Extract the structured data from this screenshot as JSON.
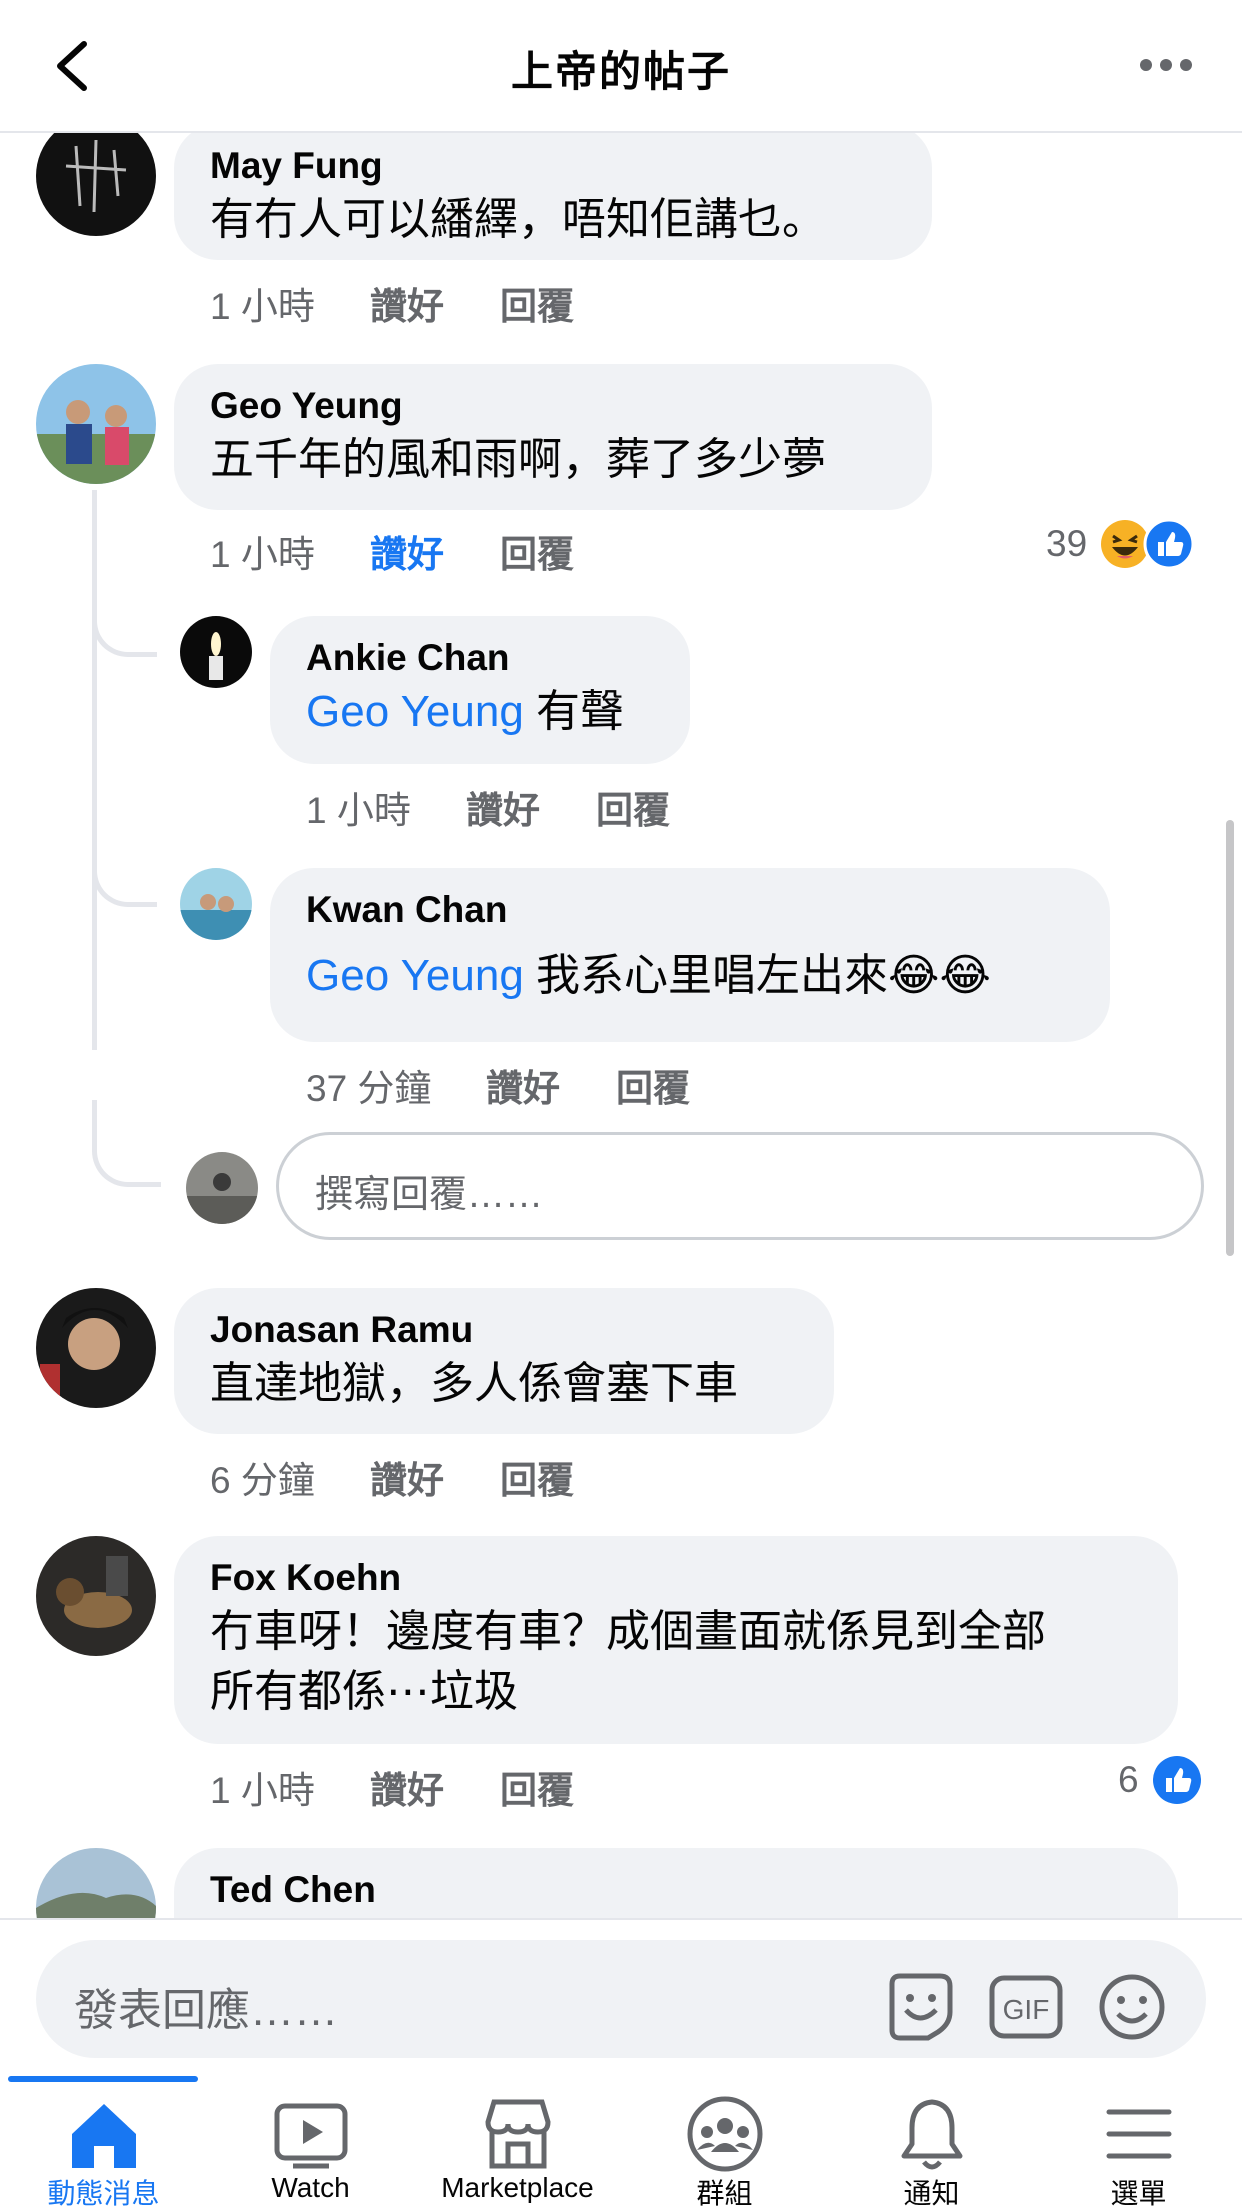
{
  "header": {
    "title": "上帝的帖子"
  },
  "comments": [
    {
      "name": "May Fung",
      "text": "有冇人可以繙繹，唔知佢講乜。",
      "time": "1 小時",
      "like": "讚好",
      "reply": "回覆"
    },
    {
      "name": "Geo Yeung",
      "text": "五千年的風和雨啊，葬了多少夢",
      "time": "1 小時",
      "like": "讚好",
      "reply": "回覆",
      "reaction_count": "39",
      "replies": [
        {
          "name": "Ankie Chan",
          "mention": "Geo Yeung",
          "text": "有聲",
          "time": "1 小時",
          "like": "讚好",
          "reply": "回覆"
        },
        {
          "name": "Kwan Chan",
          "mention": "Geo Yeung",
          "text": "我系心里唱左出來😂😂",
          "time": "37 分鐘",
          "like": "讚好",
          "reply": "回覆"
        }
      ]
    },
    {
      "name": "Jonasan Ramu",
      "text": "直達地獄，多人係會塞下車",
      "time": "6 分鐘",
      "like": "讚好",
      "reply": "回覆"
    },
    {
      "name": "Fox Koehn",
      "text_line1": "冇車呀！邊度有車？成個畫面就係見到全部",
      "text_line2": "所有都係⋯垃圾",
      "time": "1 小時",
      "like": "讚好",
      "reply": "回覆",
      "reaction_count": "6"
    },
    {
      "name": "Ted Chen"
    }
  ],
  "reply_input": {
    "placeholder": "撰寫回覆……"
  },
  "composer": {
    "placeholder": "發表回應……"
  },
  "nav": [
    {
      "label": "動態消息",
      "icon": "home-icon",
      "active": true
    },
    {
      "label": "Watch",
      "icon": "watch-icon"
    },
    {
      "label": "Marketplace",
      "icon": "marketplace-icon"
    },
    {
      "label": "群組",
      "icon": "groups-icon"
    },
    {
      "label": "通知",
      "icon": "bell-icon"
    },
    {
      "label": "選單",
      "icon": "menu-icon"
    }
  ],
  "colors": {
    "accent": "#1877f2",
    "bubble": "#f0f2f5",
    "meta": "#65676b"
  }
}
